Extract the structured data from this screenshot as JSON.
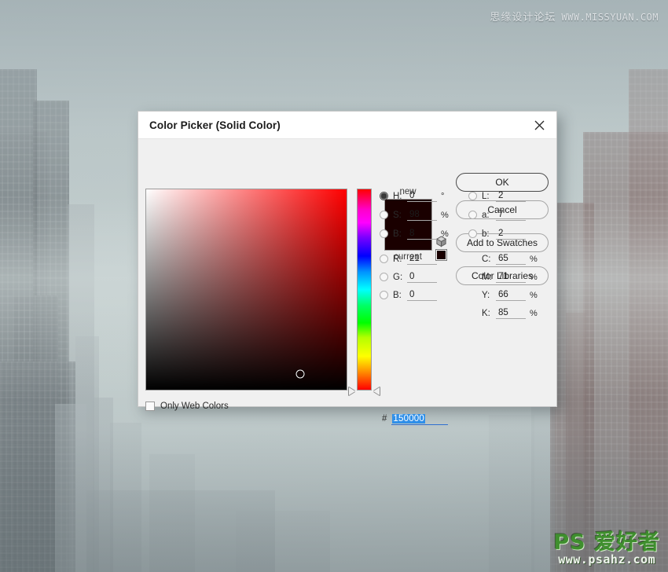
{
  "desktop": {
    "watermark_top": {
      "cn": "思缘设计论坛",
      "url": "WWW.MISSYUAN.COM"
    },
    "watermark_bottom": {
      "line1": "PS 爱好者",
      "line2": "www.psahz.com"
    }
  },
  "dialog": {
    "title": "Color Picker (Solid Color)",
    "close_icon": "close-icon",
    "preview": {
      "new_label": "new",
      "current_label": "current",
      "new_color": "#1a0000",
      "current_color": "#1a0000",
      "out_of_gamut_icon": "gamut-warning-cube-icon",
      "out_of_web_swatch_color": "#1a0000"
    },
    "buttons": {
      "ok": "OK",
      "cancel": "Cancel",
      "add_to_swatches": "Add to Swatches",
      "color_libraries": "Color Libraries"
    },
    "only_web_colors": {
      "label": "Only Web Colors",
      "checked": false
    },
    "hsb": {
      "h": {
        "label": "H:",
        "value": "0",
        "unit": "°",
        "selected": true
      },
      "s": {
        "label": "S:",
        "value": "98",
        "unit": "%",
        "selected": false
      },
      "b": {
        "label": "B:",
        "value": "8",
        "unit": "%",
        "selected": false
      }
    },
    "rgb": {
      "r": {
        "label": "R:",
        "value": "21",
        "selected": false
      },
      "g": {
        "label": "G:",
        "value": "0",
        "selected": false
      },
      "b": {
        "label": "B:",
        "value": "0",
        "selected": false
      }
    },
    "lab": {
      "l": {
        "label": "L:",
        "value": "2",
        "selected": false
      },
      "a": {
        "label": "a:",
        "value": "7",
        "selected": false
      },
      "b": {
        "label": "b:",
        "value": "2",
        "selected": false
      }
    },
    "cmyk": {
      "c": {
        "label": "C:",
        "value": "65",
        "unit": "%"
      },
      "m": {
        "label": "M:",
        "value": "71",
        "unit": "%"
      },
      "y": {
        "label": "Y:",
        "value": "66",
        "unit": "%"
      },
      "k": {
        "label": "K:",
        "value": "85",
        "unit": "%"
      }
    },
    "hex": {
      "prefix": "#",
      "value": "150000",
      "selected": true
    },
    "field": {
      "hue_base_color": "#ff0000",
      "cursor_x_pct": 76.7,
      "cursor_y_pct": 92.2
    }
  }
}
